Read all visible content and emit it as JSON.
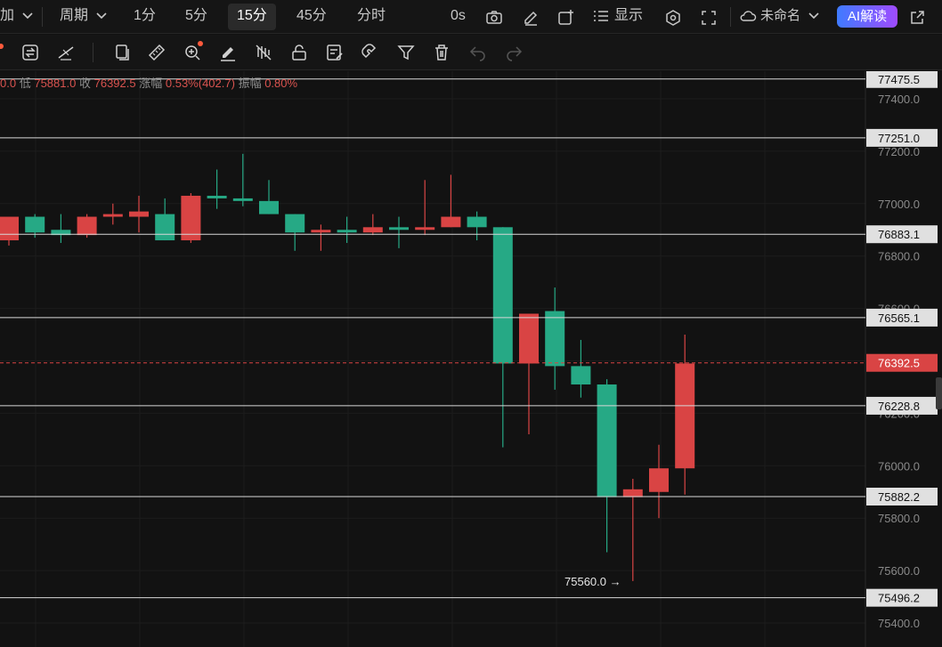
{
  "toolbar": {
    "symbol_suffix": "加",
    "period_label": "周期",
    "intervals": [
      "1分",
      "5分",
      "15分",
      "45分",
      "分时"
    ],
    "active_interval": "15分",
    "countdown": "0s",
    "display_label": "显示",
    "layout_name": "未命名",
    "ai_button": "AI解读"
  },
  "info_bar": {
    "open_tail": "0.0",
    "low_label": "低",
    "low_value": "75881.0",
    "close_label": "收",
    "close_value": "76392.5",
    "change_label": "涨幅",
    "change_value": "0.53%(402.7)",
    "amplitude_label": "振幅",
    "amplitude_value": "0.80%"
  },
  "colors": {
    "up": "#d94444",
    "down": "#26a985",
    "background": "#121212",
    "line": "#d8d8d8",
    "price_label_bg": "#e0e0e0",
    "current_price": "#d94444"
  },
  "chart_data": {
    "type": "candlestick",
    "title": "",
    "ylim": [
      75350,
      77550
    ],
    "y_ticks": [
      75400,
      75600,
      75800,
      76000,
      76200,
      76400,
      76600,
      76800,
      77000,
      77200,
      77400
    ],
    "y_tick_labels": [
      "75400.0",
      "75600.0",
      "75800.0",
      "76000.0",
      "76200.0",
      "76400.0",
      "76600.0",
      "76800.0",
      "77000.0",
      "77200.0",
      "77400.0"
    ],
    "candles": [
      {
        "o": 76860,
        "h": 76940,
        "l": 76840,
        "c": 76950
      },
      {
        "o": 76950,
        "h": 76960,
        "l": 76870,
        "c": 76890
      },
      {
        "o": 76900,
        "h": 76960,
        "l": 76850,
        "c": 76880
      },
      {
        "o": 76880,
        "h": 76960,
        "l": 76870,
        "c": 76950
      },
      {
        "o": 76950,
        "h": 77000,
        "l": 76920,
        "c": 76960
      },
      {
        "o": 76950,
        "h": 77030,
        "l": 76890,
        "c": 76970
      },
      {
        "o": 76960,
        "h": 77020,
        "l": 76860,
        "c": 76860
      },
      {
        "o": 76860,
        "h": 77040,
        "l": 76850,
        "c": 77030
      },
      {
        "o": 77030,
        "h": 77130,
        "l": 76980,
        "c": 77020
      },
      {
        "o": 77020,
        "h": 77190,
        "l": 76990,
        "c": 77010
      },
      {
        "o": 77010,
        "h": 77090,
        "l": 76960,
        "c": 76960
      },
      {
        "o": 76960,
        "h": 76960,
        "l": 76820,
        "c": 76890
      },
      {
        "o": 76890,
        "h": 76920,
        "l": 76820,
        "c": 76900
      },
      {
        "o": 76900,
        "h": 76950,
        "l": 76850,
        "c": 76890
      },
      {
        "o": 76890,
        "h": 76960,
        "l": 76880,
        "c": 76910
      },
      {
        "o": 76910,
        "h": 76950,
        "l": 76830,
        "c": 76900
      },
      {
        "o": 76900,
        "h": 77090,
        "l": 76880,
        "c": 76910
      },
      {
        "o": 76910,
        "h": 77110,
        "l": 76910,
        "c": 76950
      },
      {
        "o": 76950,
        "h": 76970,
        "l": 76860,
        "c": 76910
      },
      {
        "o": 76910,
        "h": 76910,
        "l": 76070,
        "c": 76390
      },
      {
        "o": 76390,
        "h": 76580,
        "l": 76120,
        "c": 76580
      },
      {
        "o": 76590,
        "h": 76680,
        "l": 76290,
        "c": 76380
      },
      {
        "o": 76380,
        "h": 76480,
        "l": 76260,
        "c": 76310
      },
      {
        "o": 76310,
        "h": 76330,
        "l": 75670,
        "c": 75880
      },
      {
        "o": 75880,
        "h": 75950,
        "l": 75560,
        "c": 75910
      },
      {
        "o": 75900,
        "h": 76080,
        "l": 75800,
        "c": 75990
      },
      {
        "o": 75990,
        "h": 76500,
        "l": 75890,
        "c": 76390
      }
    ],
    "horizontal_lines": [
      {
        "value": 77475.5,
        "label": "77475.5"
      },
      {
        "value": 77251.0,
        "label": "77251.0"
      },
      {
        "value": 76883.1,
        "label": "76883.1"
      },
      {
        "value": 76565.1,
        "label": "76565.1"
      },
      {
        "value": 76228.8,
        "label": "76228.8"
      },
      {
        "value": 75882.2,
        "label": "75882.2"
      },
      {
        "value": 75496.2,
        "label": "75496.2"
      }
    ],
    "current_price": {
      "value": 76392.5,
      "label": "76392.5"
    },
    "low_marker": {
      "value": 75560.0,
      "label": "75560.0 →"
    }
  }
}
